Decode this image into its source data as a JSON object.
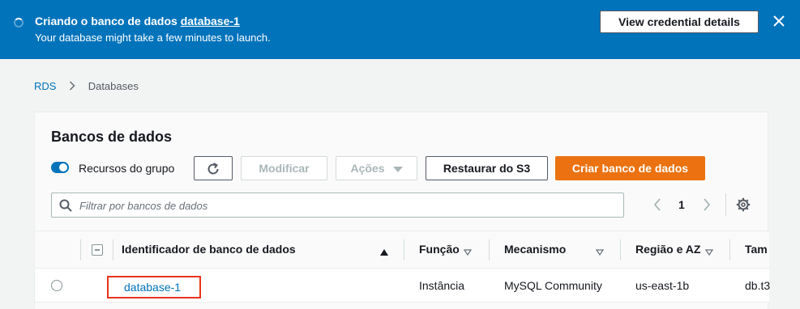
{
  "banner": {
    "title_prefix": "Criando o banco de dados",
    "title_link": "database-1",
    "message": "Your database might take a few minutes to launch.",
    "button_label": "View credential details",
    "background_color": "#0073bb",
    "close_icon": "close-icon"
  },
  "breadcrumb": {
    "items": [
      {
        "label": "RDS"
      },
      {
        "label": "Databases"
      }
    ]
  },
  "panel": {
    "title": "Bancos de dados",
    "toggle_label": "Recursos do grupo",
    "toggle_on": true,
    "buttons": {
      "refresh_icon": "refresh-icon",
      "modify": "Modificar",
      "actions": "Ações",
      "restore": "Restaurar do S3",
      "create": "Criar banco de dados"
    },
    "filter_placeholder": "Filtrar por bancos de dados",
    "pagination": {
      "current_page": "1"
    },
    "primary_color": "#ec7211"
  },
  "table": {
    "columns": [
      {
        "label": "Identificador de banco de dados",
        "sort": "ascending"
      },
      {
        "label": "Função",
        "sort": "sortable"
      },
      {
        "label": "Mecanismo",
        "sort": "sortable"
      },
      {
        "label": "Região e AZ",
        "sort": "sortable"
      },
      {
        "label": "Tam",
        "sort": "none"
      }
    ],
    "rows": [
      {
        "identifier": "database-1",
        "role": "Instância",
        "engine": "MySQL Community",
        "region_az": "us-east-1b",
        "size": "db.t3"
      }
    ],
    "highlight_color": "#e8331c"
  }
}
